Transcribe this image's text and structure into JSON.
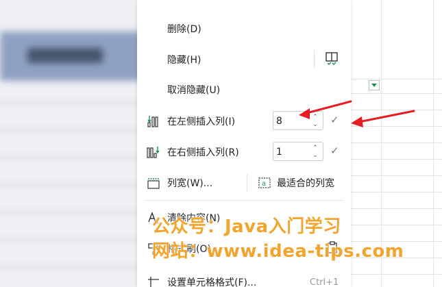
{
  "menu": {
    "delete": "删除(D)",
    "hide": "隐藏(H)",
    "unhide": "取消隐藏(U)",
    "insert_left": {
      "label": "在左侧插入列(I)",
      "value": "8"
    },
    "insert_right": {
      "label": "在右侧插入列(R)",
      "value": "1"
    },
    "column_width": "列宽(W)...",
    "best_fit": "最适合的列宽",
    "clear_contents": "清除内容(N)",
    "format_painter": "格式刷(O)",
    "format_cells": "设置单元格格式(F)...",
    "format_cells_shortcut": "Ctrl+1"
  },
  "icons": {
    "spin_up": "⌃",
    "spin_down": "⌄",
    "check": "✓"
  },
  "watermark": {
    "line1": "公众号：Java入门学习",
    "line2": "网站：www.idea-tips.com"
  },
  "colors": {
    "arrow": "#e51c23",
    "watermark": "#f2a52e",
    "icon_accent": "#1e8e4e"
  }
}
